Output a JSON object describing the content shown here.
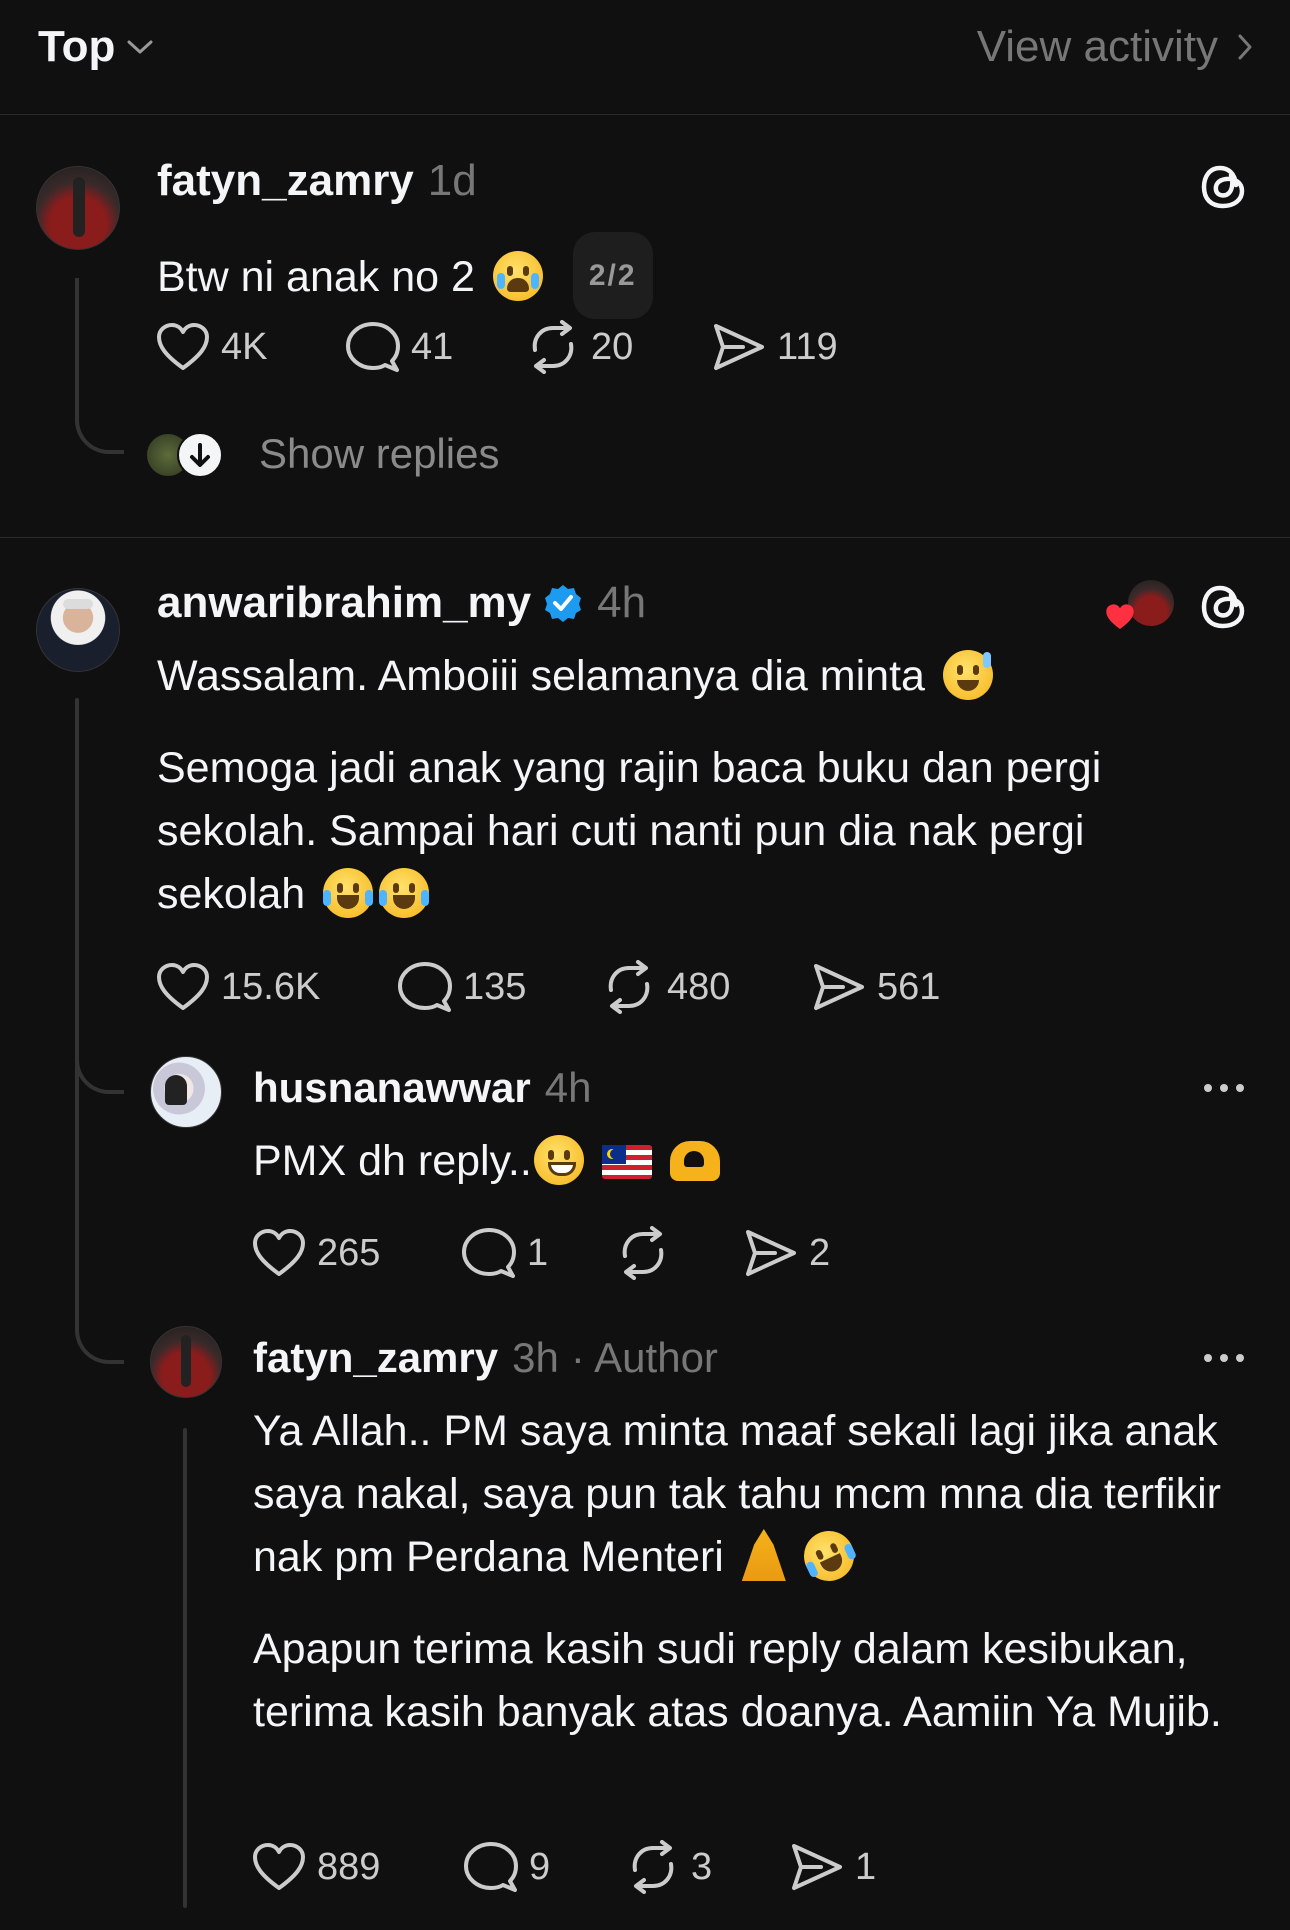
{
  "header": {
    "sort_label": "Top",
    "view_activity_label": "View activity"
  },
  "posts": [
    {
      "username": "fatyn_zamry",
      "time": "1d",
      "text": "Btw ni anak no 2",
      "pager": "2/2",
      "likes": "4K",
      "comments": "41",
      "reposts": "20",
      "shares": "119",
      "show_replies_label": "Show replies"
    },
    {
      "username": "anwaribrahim_my",
      "verified": true,
      "time": "4h",
      "paragraph1": "Wassalam. Amboiii selamanya dia minta",
      "paragraph2": "Semoga jadi anak yang rajin baca buku dan pergi sekolah. Sampai hari cuti nanti pun dia nak pergi sekolah",
      "likes": "15.6K",
      "comments": "135",
      "reposts": "480",
      "shares": "561"
    }
  ],
  "replies": [
    {
      "username": "husnanawwar",
      "time": "4h",
      "text": "PMX dh reply..",
      "likes": "265",
      "comments": "1",
      "reposts": "",
      "shares": "2"
    },
    {
      "username": "fatyn_zamry",
      "time": "3h",
      "badge": "· Author",
      "paragraph1": "Ya Allah.. PM saya minta maaf sekali lagi jika anak saya nakal, saya pun tak tahu mcm mna dia terfikir nak pm Perdana Menteri",
      "paragraph2": "Apapun terima kasih sudi reply dalam kesibukan, terima kasih banyak atas doanya. Aamiin Ya Mujib.",
      "likes": "889",
      "comments": "9",
      "reposts": "3",
      "shares": "1"
    }
  ],
  "icons": {
    "like": "heart-icon",
    "comment": "comment-bubble-icon",
    "repost": "repost-icon",
    "share": "send-icon",
    "threads": "threads-logo-icon",
    "more": "more-dots-icon"
  },
  "colors": {
    "background": "#101010",
    "text": "#f3f5f7",
    "muted": "#777777",
    "verified": "#1d9bf0",
    "liked_heart": "#ff3040"
  }
}
